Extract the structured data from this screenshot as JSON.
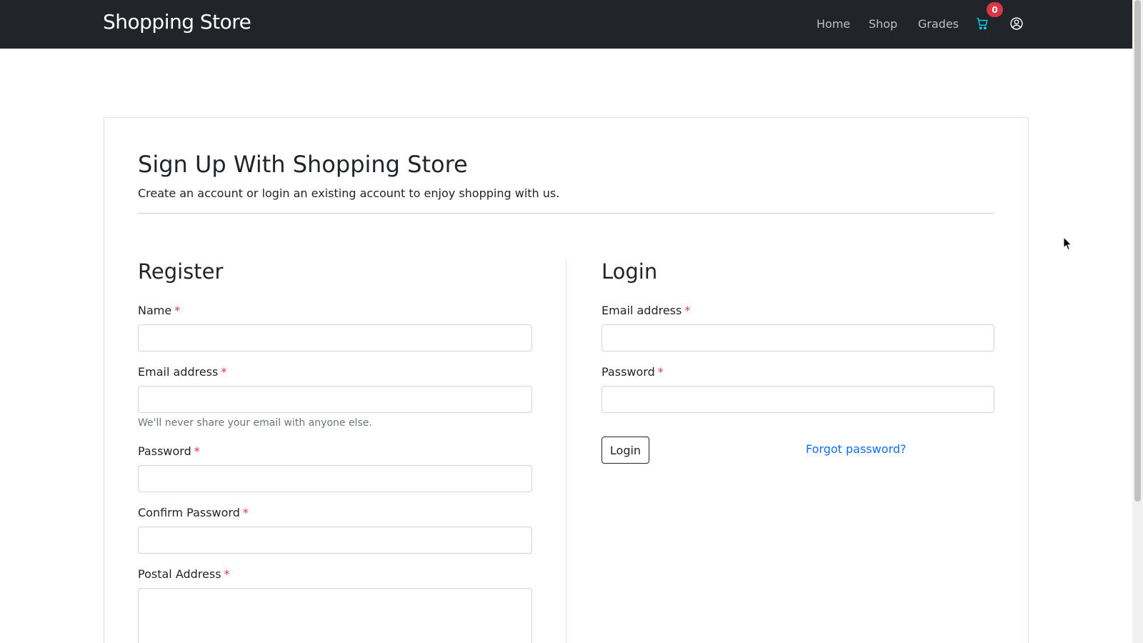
{
  "navbar": {
    "brand": "Shopping Store",
    "links": [
      "Home",
      "Shop",
      "Grades"
    ],
    "cart_count": "0",
    "cart_icon": "cart-icon",
    "user_icon": "user-circle-icon"
  },
  "page": {
    "title": "Sign Up With Shopping Store",
    "subtitle": "Create an account or login an existing account to enjoy shopping with us."
  },
  "register": {
    "title": "Register",
    "fields": {
      "name": {
        "label": "Name",
        "required": "*",
        "value": ""
      },
      "email": {
        "label": "Email address",
        "required": "*",
        "value": "",
        "help": "We'll never share your email with anyone else."
      },
      "password": {
        "label": "Password",
        "required": "*",
        "value": ""
      },
      "confirm_password": {
        "label": "Confirm Password",
        "required": "*",
        "value": ""
      },
      "postal_address": {
        "label": "Postal Address",
        "required": "*",
        "value": ""
      }
    }
  },
  "login": {
    "title": "Login",
    "fields": {
      "email": {
        "label": "Email address",
        "required": "*",
        "value": ""
      },
      "password": {
        "label": "Password",
        "required": "*",
        "value": ""
      }
    },
    "submit_label": "Login",
    "forgot_label": "Forgot password?"
  },
  "colors": {
    "navbar_bg": "#212529",
    "accent_link": "#0d6efd",
    "required": "#dc3545",
    "cart_icon": "#0dcaf0"
  }
}
